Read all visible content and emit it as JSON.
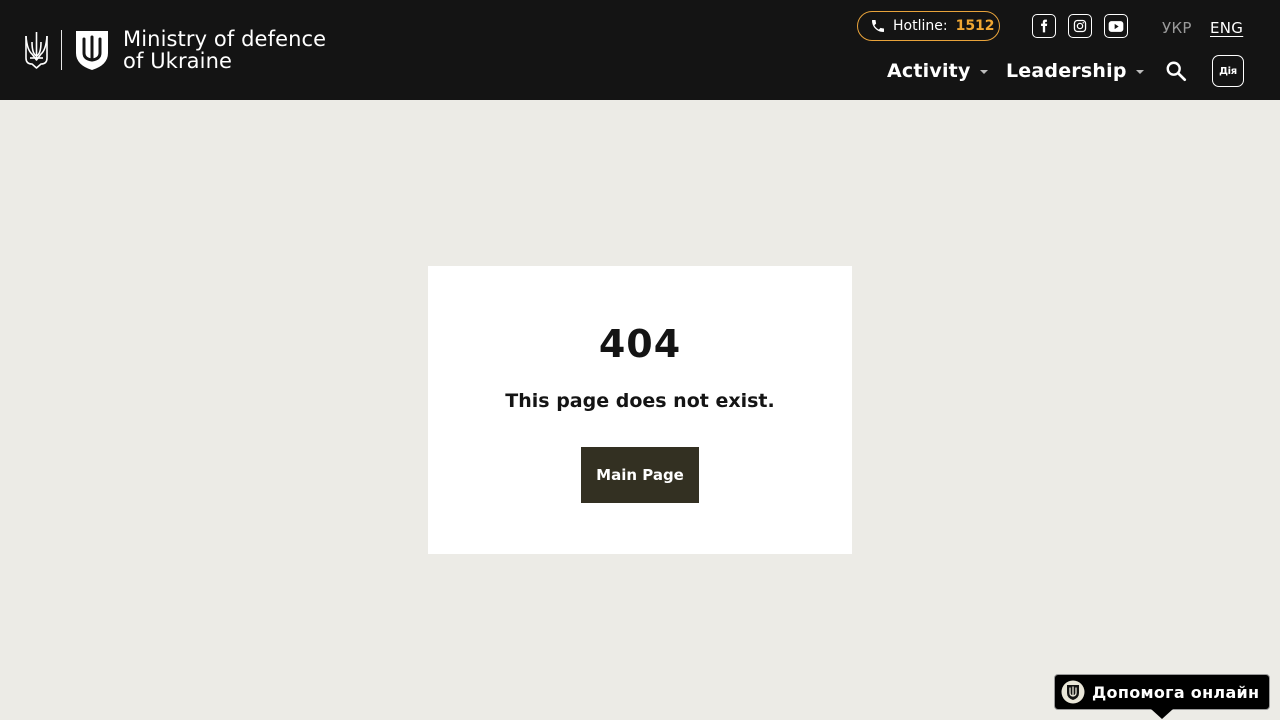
{
  "header": {
    "logo_line1": "Ministry of defence",
    "logo_line2": "of Ukraine",
    "hotline_label": "Hotline:",
    "hotline_number": "1512",
    "hotline_color": "#f0a732",
    "social": [
      "facebook-icon",
      "instagram-icon",
      "youtube-icon"
    ],
    "languages": [
      {
        "label": "УКР",
        "active": false
      },
      {
        "label": "ENG",
        "active": true
      }
    ],
    "nav": [
      {
        "label": "Activity"
      },
      {
        "label": "Leadership"
      }
    ],
    "search_icon": "search-icon",
    "diia_label": "Дія"
  },
  "main": {
    "code": "404",
    "message": "This page does not exist.",
    "button_label": "Main Page",
    "button_color": "#333022"
  },
  "help_widget": {
    "label": "Допомога онлайн"
  }
}
